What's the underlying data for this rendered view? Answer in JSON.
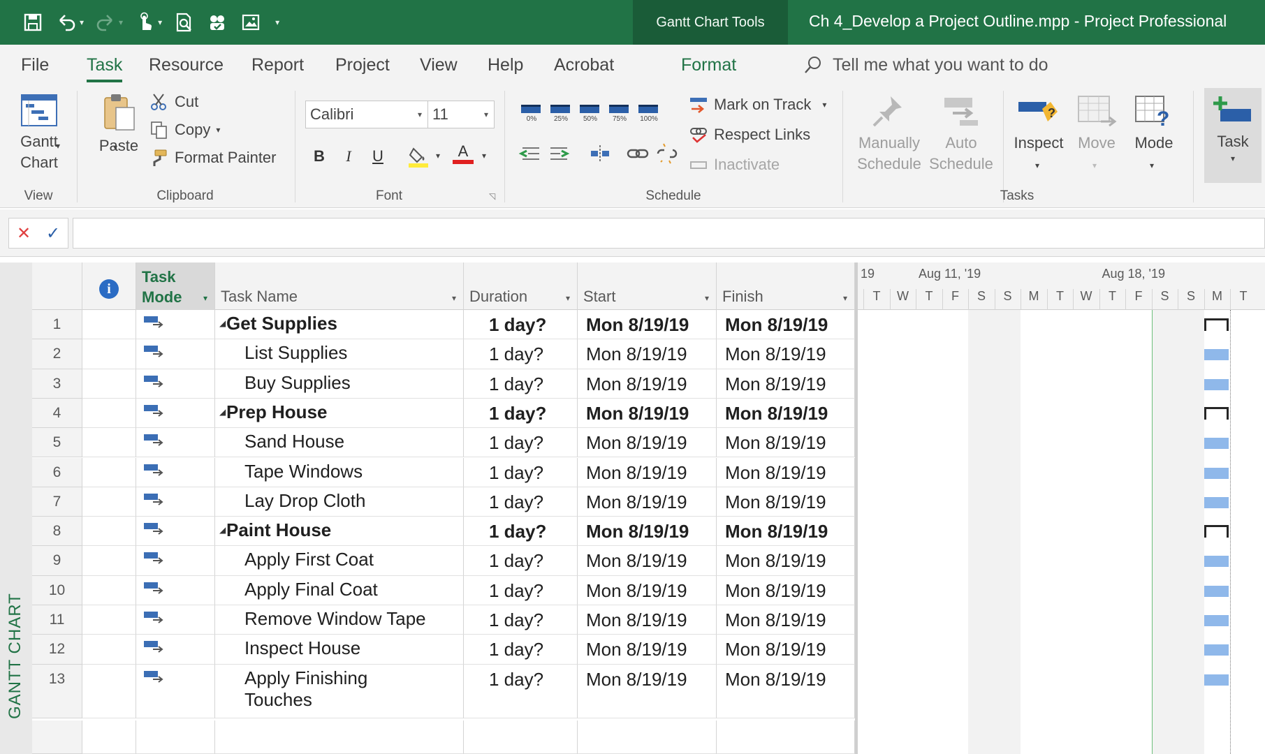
{
  "titlebar": {
    "contextual_tab": "Gantt Chart Tools",
    "document_title": "Ch 4_Develop a Project Outline.mpp  -  Project Professional"
  },
  "tabs": [
    {
      "label": "File"
    },
    {
      "label": "Task"
    },
    {
      "label": "Resource"
    },
    {
      "label": "Report"
    },
    {
      "label": "Project"
    },
    {
      "label": "View"
    },
    {
      "label": "Help"
    },
    {
      "label": "Acrobat"
    },
    {
      "label": "Format"
    }
  ],
  "tellme": {
    "placeholder": "Tell me what you want to do"
  },
  "ribbon": {
    "view": {
      "gantt_label": "Gantt\nChart",
      "group": "View"
    },
    "clipboard": {
      "paste": "Paste",
      "cut": "Cut",
      "copy": "Copy",
      "format_painter": "Format Painter",
      "group": "Clipboard"
    },
    "font": {
      "family": "Calibri",
      "size": "11",
      "bold": "B",
      "italic": "I",
      "underline": "U",
      "font_color": "A",
      "group": "Font"
    },
    "schedule": {
      "percents": [
        "0%",
        "25%",
        "50%",
        "75%",
        "100%"
      ],
      "mark_on_track": "Mark on Track",
      "respect_links": "Respect Links",
      "inactivate": "Inactivate",
      "group": "Schedule"
    },
    "tasks": {
      "manually": "Manually\nSchedule",
      "auto": "Auto\nSchedule",
      "inspect": "Inspect",
      "move": "Move",
      "mode": "Mode",
      "group": "Tasks"
    },
    "insert": {
      "task": "Task"
    }
  },
  "sheet": {
    "headers": {
      "info": "i",
      "mode_line1": "Task",
      "mode_line2": "Mode",
      "name": "Task Name",
      "duration": "Duration",
      "start": "Start",
      "finish": "Finish"
    },
    "rows": [
      {
        "id": "1",
        "name": "Get Supplies",
        "summary": true,
        "duration": "1 day?",
        "start": "Mon 8/19/19",
        "finish": "Mon 8/19/19"
      },
      {
        "id": "2",
        "name": "List Supplies",
        "summary": false,
        "duration": "1 day?",
        "start": "Mon 8/19/19",
        "finish": "Mon 8/19/19"
      },
      {
        "id": "3",
        "name": "Buy Supplies",
        "summary": false,
        "duration": "1 day?",
        "start": "Mon 8/19/19",
        "finish": "Mon 8/19/19"
      },
      {
        "id": "4",
        "name": "Prep House",
        "summary": true,
        "duration": "1 day?",
        "start": "Mon 8/19/19",
        "finish": "Mon 8/19/19"
      },
      {
        "id": "5",
        "name": "Sand House",
        "summary": false,
        "duration": "1 day?",
        "start": "Mon 8/19/19",
        "finish": "Mon 8/19/19"
      },
      {
        "id": "6",
        "name": "Tape Windows",
        "summary": false,
        "duration": "1 day?",
        "start": "Mon 8/19/19",
        "finish": "Mon 8/19/19"
      },
      {
        "id": "7",
        "name": "Lay Drop Cloth",
        "summary": false,
        "duration": "1 day?",
        "start": "Mon 8/19/19",
        "finish": "Mon 8/19/19"
      },
      {
        "id": "8",
        "name": "Paint House",
        "summary": true,
        "duration": "1 day?",
        "start": "Mon 8/19/19",
        "finish": "Mon 8/19/19"
      },
      {
        "id": "9",
        "name": "Apply First Coat",
        "summary": false,
        "duration": "1 day?",
        "start": "Mon 8/19/19",
        "finish": "Mon 8/19/19"
      },
      {
        "id": "10",
        "name": "Apply Final Coat",
        "summary": false,
        "duration": "1 day?",
        "start": "Mon 8/19/19",
        "finish": "Mon 8/19/19"
      },
      {
        "id": "11",
        "name": "Remove Window Tape",
        "summary": false,
        "duration": "1 day?",
        "start": "Mon 8/19/19",
        "finish": "Mon 8/19/19"
      },
      {
        "id": "12",
        "name": "Inspect House",
        "summary": false,
        "duration": "1 day?",
        "start": "Mon 8/19/19",
        "finish": "Mon 8/19/19"
      },
      {
        "id": "13",
        "name": "Apply Finishing\nTouches",
        "summary": false,
        "duration": "1 day?",
        "start": "Mon 8/19/19",
        "finish": "Mon 8/19/19"
      }
    ]
  },
  "timescale": {
    "weeks": [
      "19",
      "Aug 11, '19",
      "Aug 18, '19"
    ],
    "days": [
      "T",
      "W",
      "T",
      "F",
      "S",
      "S",
      "M",
      "T",
      "W",
      "T",
      "F",
      "S",
      "S",
      "M",
      "T"
    ]
  },
  "viewbar": {
    "label": "GANTT CHART"
  },
  "colors": {
    "brand": "#217346",
    "task_bar": "#8fb8ea",
    "summary_bar": "#262626",
    "mode_icon": "#3b6eb5"
  }
}
